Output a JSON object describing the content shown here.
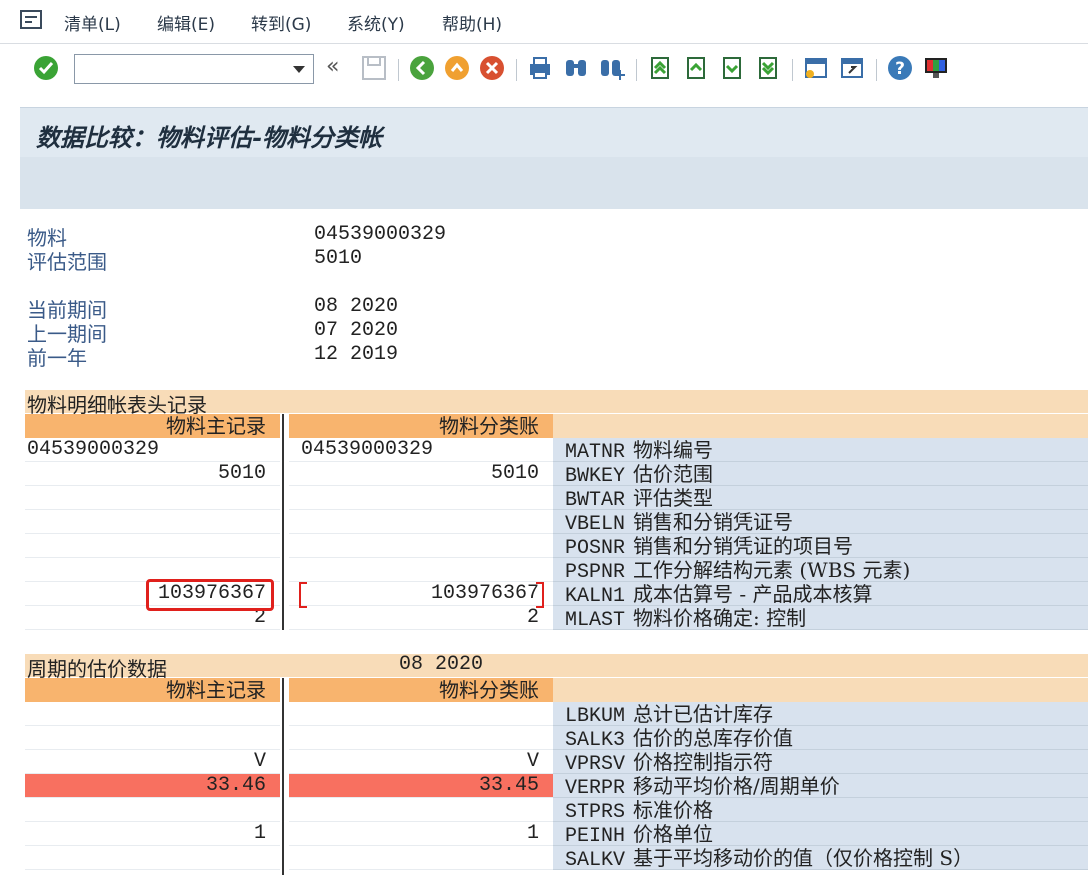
{
  "menu": {
    "items": [
      "清单(L)",
      "编辑(E)",
      "转到(G)",
      "系统(Y)",
      "帮助(H)"
    ]
  },
  "toolbar": {
    "command_value": "",
    "icons": [
      "check-icon",
      "save-icon",
      "back-icon",
      "exit-icon",
      "cancel-icon",
      "print-icon",
      "find-icon",
      "find-next-icon",
      "first-page-icon",
      "prev-page-icon",
      "next-page-icon",
      "last-page-icon",
      "new-session-icon",
      "shortcut-icon",
      "help-icon",
      "layout-icon"
    ]
  },
  "title": "数据比较：物料评估-物料分类帐",
  "header": {
    "material_label": "物料",
    "material_value": "04539000329",
    "valuation_area_label": "评估范围",
    "valuation_area_value": "5010",
    "current_period_label": "当前期间",
    "current_period_value": "08 2020",
    "previous_period_label": "上一期间",
    "previous_period_value": "07 2020",
    "previous_year_label": "前一年",
    "previous_year_value": "12 2019"
  },
  "section1": {
    "title": "物料明细帐表头记录",
    "col1": "物料主记录",
    "col2": "物料分类账",
    "rows": [
      {
        "left": "04539000329",
        "right": "04539000329",
        "code": "MATNR",
        "desc": "物料编号",
        "align": "left"
      },
      {
        "left": "5010",
        "right": "5010",
        "code": "BWKEY",
        "desc": "估价范围",
        "align": "right"
      },
      {
        "left": "",
        "right": "",
        "code": "BWTAR",
        "desc": "评估类型",
        "align": "right"
      },
      {
        "left": "",
        "right": "",
        "code": "VBELN",
        "desc": "销售和分销凭证号",
        "align": "right"
      },
      {
        "left": "",
        "right": "",
        "code": "POSNR",
        "desc": "销售和分销凭证的项目号",
        "align": "right"
      },
      {
        "left": "",
        "right": "",
        "code": "PSPNR",
        "desc": "工作分解结构元素 (WBS 元素)",
        "align": "right"
      },
      {
        "left": "103976367",
        "right": "103976367",
        "code": "KALN1",
        "desc": "成本估算号 - 产品成本核算",
        "align": "right"
      },
      {
        "left": "2",
        "right": "2",
        "code": "MLAST",
        "desc": "物料价格确定: 控制",
        "align": "right"
      }
    ]
  },
  "section2": {
    "title": "周期的估价数据",
    "period": "08 2020",
    "col1": "物料主记录",
    "col2": "物料分类账",
    "rows": [
      {
        "left": "",
        "right": "",
        "code": "LBKUM",
        "desc": "总计已估计库存",
        "red": false
      },
      {
        "left": "",
        "right": "",
        "code": "SALK3",
        "desc": "估价的总库存价值",
        "red": false
      },
      {
        "left": "V",
        "right": "V",
        "code": "VPRSV",
        "desc": "价格控制指示符",
        "red": false
      },
      {
        "left": "33.46",
        "right": "33.45",
        "code": "VERPR",
        "desc": "移动平均价格/周期单价",
        "red": true
      },
      {
        "left": "",
        "right": "",
        "code": "STPRS",
        "desc": "标准价格",
        "red": false
      },
      {
        "left": "1",
        "right": "1",
        "code": "PEINH",
        "desc": "价格单位",
        "red": false
      },
      {
        "left": "",
        "right": "",
        "code": "SALKV",
        "desc": "基于平均移动价的值（仅价格控制 S）",
        "red": false
      }
    ]
  },
  "colors": {
    "col_header": "#f8b46e",
    "section_header": "#f8dcb8",
    "field_desc_bg": "#d8e2ee",
    "diff_red": "#f87060",
    "highlight_box": "#e0201c"
  }
}
